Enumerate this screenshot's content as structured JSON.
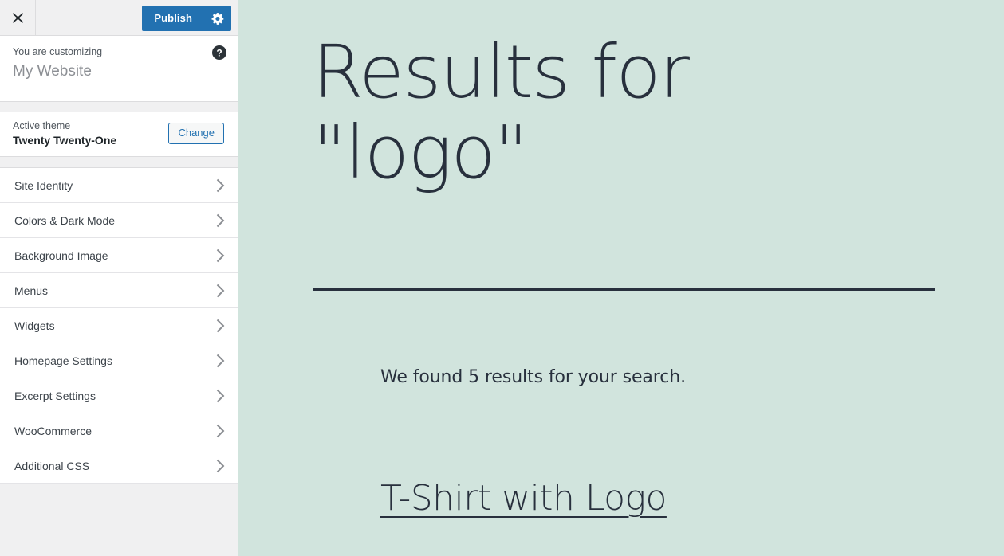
{
  "customizer": {
    "close_label": "Close customizer",
    "publish_label": "Publish",
    "gear_label": "Publish settings",
    "help_label": "Help",
    "eyebrow": "You are customizing",
    "site_title": "My Website",
    "theme_label": "Active theme",
    "theme_name": "Twenty Twenty-One",
    "change_label": "Change",
    "sections": [
      {
        "label": "Site Identity"
      },
      {
        "label": "Colors & Dark Mode"
      },
      {
        "label": "Background Image"
      },
      {
        "label": "Menus"
      },
      {
        "label": "Widgets"
      },
      {
        "label": "Homepage Settings"
      },
      {
        "label": "Excerpt Settings"
      },
      {
        "label": "WooCommerce"
      },
      {
        "label": "Additional CSS"
      }
    ]
  },
  "preview": {
    "heading_line1": "Results for",
    "heading_line2": "\"logo\"",
    "results_text": "We found 5 results for your search.",
    "product_title": "T-Shirt with Logo"
  },
  "colors": {
    "preview_background": "#d1e4dd",
    "preview_text": "#28303d",
    "publish_blue": "#2271b1",
    "panel_background": "#f0f0f1"
  }
}
